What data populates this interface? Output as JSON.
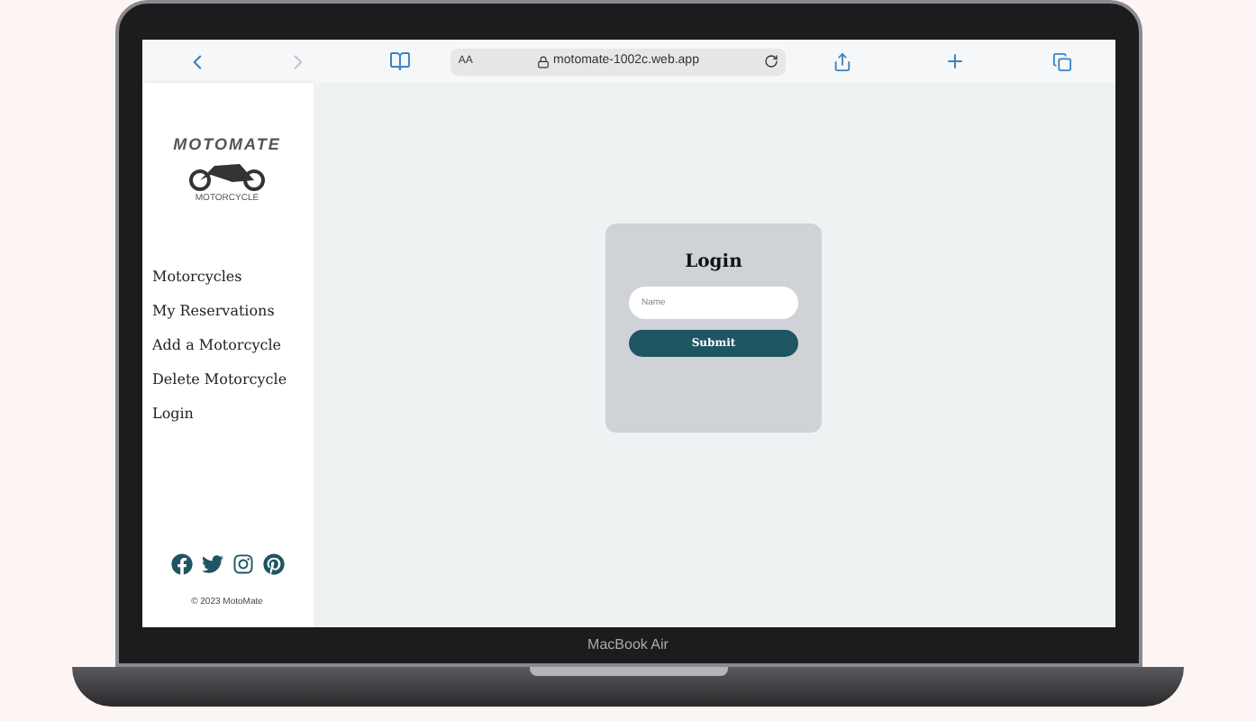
{
  "device": {
    "label": "MacBook Air"
  },
  "browser": {
    "text_size": "AA",
    "url": "motomate-1002c.web.app"
  },
  "logo": {
    "name": "MOTOMATE",
    "tagline": "MOTORCYCLE"
  },
  "nav": [
    {
      "label": "Motorcycles"
    },
    {
      "label": "My Reservations"
    },
    {
      "label": "Add a Motorcycle"
    },
    {
      "label": "Delete Motorcycle"
    },
    {
      "label": "Login"
    }
  ],
  "copyright": "© 2023 MotoMate",
  "login": {
    "title": "Login",
    "placeholder": "Name",
    "submit": "Submit"
  }
}
